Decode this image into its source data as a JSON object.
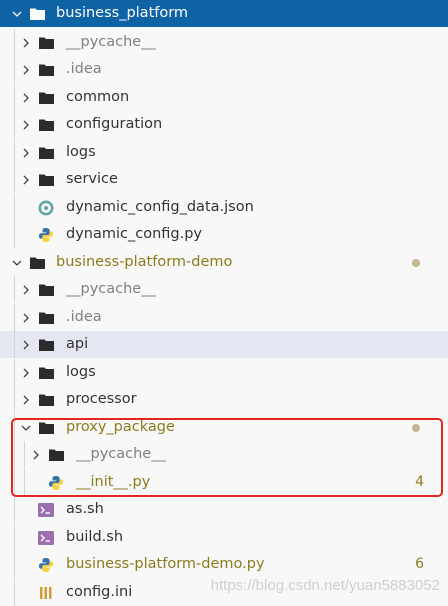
{
  "colors": {
    "selection": "#0e63a4",
    "modified": "#8e7a1e",
    "muted": "#808080",
    "highlight_box": "#e5261f",
    "python_blue": "#3572a5",
    "python_yellow": "#f7d23e",
    "shell": "#9b6fb0",
    "json": "#5fa8a0"
  },
  "tree": {
    "rows": [
      {
        "label": "business_platform",
        "icon": "folder-icon",
        "twisty": "chevron-down-icon",
        "state": "selected",
        "style": "normal"
      },
      {
        "label": "__pycache__",
        "icon": "folder-icon",
        "twisty": "chevron-right-icon",
        "style": "muted"
      },
      {
        "label": ".idea",
        "icon": "folder-icon",
        "twisty": "chevron-right-icon",
        "style": "muted"
      },
      {
        "label": "common",
        "icon": "folder-icon",
        "twisty": "chevron-right-icon",
        "style": "normal"
      },
      {
        "label": "configuration",
        "icon": "folder-icon",
        "twisty": "chevron-right-icon",
        "style": "normal"
      },
      {
        "label": "logs",
        "icon": "folder-icon",
        "twisty": "chevron-right-icon",
        "style": "normal"
      },
      {
        "label": "service",
        "icon": "folder-icon",
        "twisty": "chevron-right-icon",
        "style": "normal"
      },
      {
        "label": "dynamic_config_data.json",
        "icon": "json-file-icon",
        "style": "normal"
      },
      {
        "label": "dynamic_config.py",
        "icon": "python-file-icon",
        "style": "normal"
      },
      {
        "label": "business-platform-demo",
        "icon": "folder-icon",
        "twisty": "chevron-down-icon",
        "style": "modified",
        "decoration": "dot"
      },
      {
        "label": "__pycache__",
        "icon": "folder-icon",
        "twisty": "chevron-right-icon",
        "style": "muted"
      },
      {
        "label": ".idea",
        "icon": "folder-icon",
        "twisty": "chevron-right-icon",
        "style": "muted"
      },
      {
        "label": "api",
        "icon": "folder-icon",
        "twisty": "chevron-right-icon",
        "state": "hover",
        "style": "normal"
      },
      {
        "label": "logs",
        "icon": "folder-icon",
        "twisty": "chevron-right-icon",
        "style": "normal"
      },
      {
        "label": "processor",
        "icon": "folder-icon",
        "twisty": "chevron-right-icon",
        "style": "normal"
      },
      {
        "label": "proxy_package",
        "icon": "folder-icon",
        "twisty": "chevron-down-icon",
        "style": "modified",
        "decoration": "dot"
      },
      {
        "label": "__pycache__",
        "icon": "folder-icon",
        "twisty": "chevron-right-icon",
        "style": "muted"
      },
      {
        "label": "__init__.py",
        "icon": "python-file-icon",
        "style": "modified",
        "badge": "4"
      },
      {
        "label": "as.sh",
        "icon": "shell-file-icon",
        "style": "normal"
      },
      {
        "label": "build.sh",
        "icon": "shell-file-icon",
        "style": "normal"
      },
      {
        "label": "business-platform-demo.py",
        "icon": "python-file-icon",
        "style": "modified",
        "badge": "6"
      },
      {
        "label": "config.ini",
        "icon": "ini-file-icon",
        "style": "normal"
      }
    ]
  },
  "watermark": "https://blog.csdn.net/yuan5883052"
}
